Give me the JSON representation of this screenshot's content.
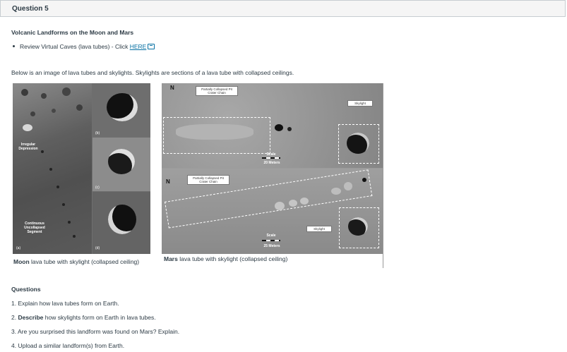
{
  "question": {
    "title": "Question 5"
  },
  "section": {
    "heading": "Volcanic Landforms on the Moon and Mars"
  },
  "review": {
    "text": "Review Virtual Caves (lava tubes) - Click ",
    "link": "HERE"
  },
  "intro": "Below is an image of lava tubes and skylights.  Skylights are sections of a lava tube with collapsed ceilings.",
  "moon_figure": {
    "label_irregular": "Irregular Depression",
    "label_continuous": "Continuous Uncollapsed Segment",
    "panels": [
      "(a)",
      "(b)",
      "(c)",
      "(d)"
    ],
    "caption_bold": "Moon",
    "caption_rest": " lava tube with skylight (collapsed ceiling)"
  },
  "mars_figure": {
    "north": "N",
    "top_box": "Partially Collapsed Pit Crater Chain",
    "top_skylight": "Skylight",
    "top_scale": "Scale",
    "top_scale_value": "20 Meters",
    "bottom_box": "Partially Collapsed Pit Crater Chain",
    "bottom_skylight": "Skylight",
    "bottom_scale": "Scale",
    "bottom_scale_value": "25 Meters",
    "caption_bold": "Mars",
    "caption_rest": " lava tube with skylight (collapsed ceiling)"
  },
  "questions": {
    "heading": "Questions",
    "q1": "1. Explain how lava tubes form on Earth.",
    "q2_num": "2. ",
    "q2_bold": "Describe",
    "q2_rest": " how skylights form on Earth in lava tubes.",
    "q3": "3. Are you surprised this landform was found on Mars? Explain.",
    "q4": "4. Upload a similar landform(s) from Earth."
  }
}
